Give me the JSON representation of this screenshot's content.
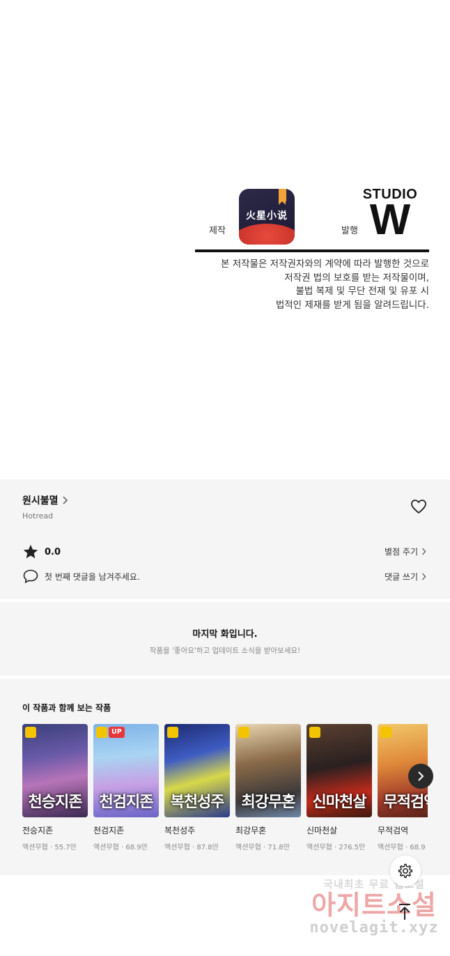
{
  "credits": {
    "production_label": "제작",
    "app_logo_text": "火星小说",
    "publisher_label": "발행",
    "studio_line1": "STUDIO",
    "studio_line2": "W",
    "notice_lines": [
      "본 저작물은 저작권자와의 계약에 따라 발행한 것으로",
      "저작권 법의 보호를 받는 저작물이며,",
      "불법 복제 및 무단 전재 및 유포 시",
      "법적인 제재를 받게 됨을 알려드립니다."
    ]
  },
  "series": {
    "title": "원시불멸",
    "publisher": "Hotread",
    "rating": "0.0",
    "rate_link": "별점 주기",
    "comment_prompt": "첫 번째 댓글을 남겨주세요.",
    "comment_link": "댓글 쓰기"
  },
  "last_chapter": {
    "title": "마지막 화입니다.",
    "subtitle": "작품을 '좋아요'하고 업데이트 소식을 받아보세요!"
  },
  "recommendations": {
    "heading": "이 작품과 함께 보는 작품",
    "items": [
      {
        "title": "전승지존",
        "genre": "액션무협",
        "views": "55.7만",
        "cover_text": "천승지존",
        "up": false
      },
      {
        "title": "천검지존",
        "genre": "액션무협",
        "views": "68.9만",
        "cover_text": "천검지존",
        "up": true,
        "badge": "UP"
      },
      {
        "title": "복천성주",
        "genre": "액션무협",
        "views": "87.8만",
        "cover_text": "복천성주",
        "up": false
      },
      {
        "title": "최강무혼",
        "genre": "액션무협",
        "views": "71.8만",
        "cover_text": "최강무혼",
        "up": false
      },
      {
        "title": "신마천살",
        "genre": "액션무협",
        "views": "276.5만",
        "cover_text": "신마천살",
        "up": false
      },
      {
        "title": "무적검역",
        "genre": "액션무협",
        "views": "68.9",
        "cover_text": "무적검역",
        "up": false
      }
    ]
  },
  "watermark": {
    "line1": "국내최초 무료 웹소설",
    "line2": "아지트소설",
    "line3": "novelagit.xyz"
  },
  "colors": {
    "section_bg": "#f5f5f5",
    "up_badge": "#e8363a",
    "clock_badge": "#f5c400",
    "watermark_red": "#e88a8a"
  },
  "icons": [
    "heart-icon",
    "star-icon",
    "comment-icon",
    "chevron-right-icon",
    "gear-icon",
    "arrow-up-icon",
    "clock-icon"
  ]
}
